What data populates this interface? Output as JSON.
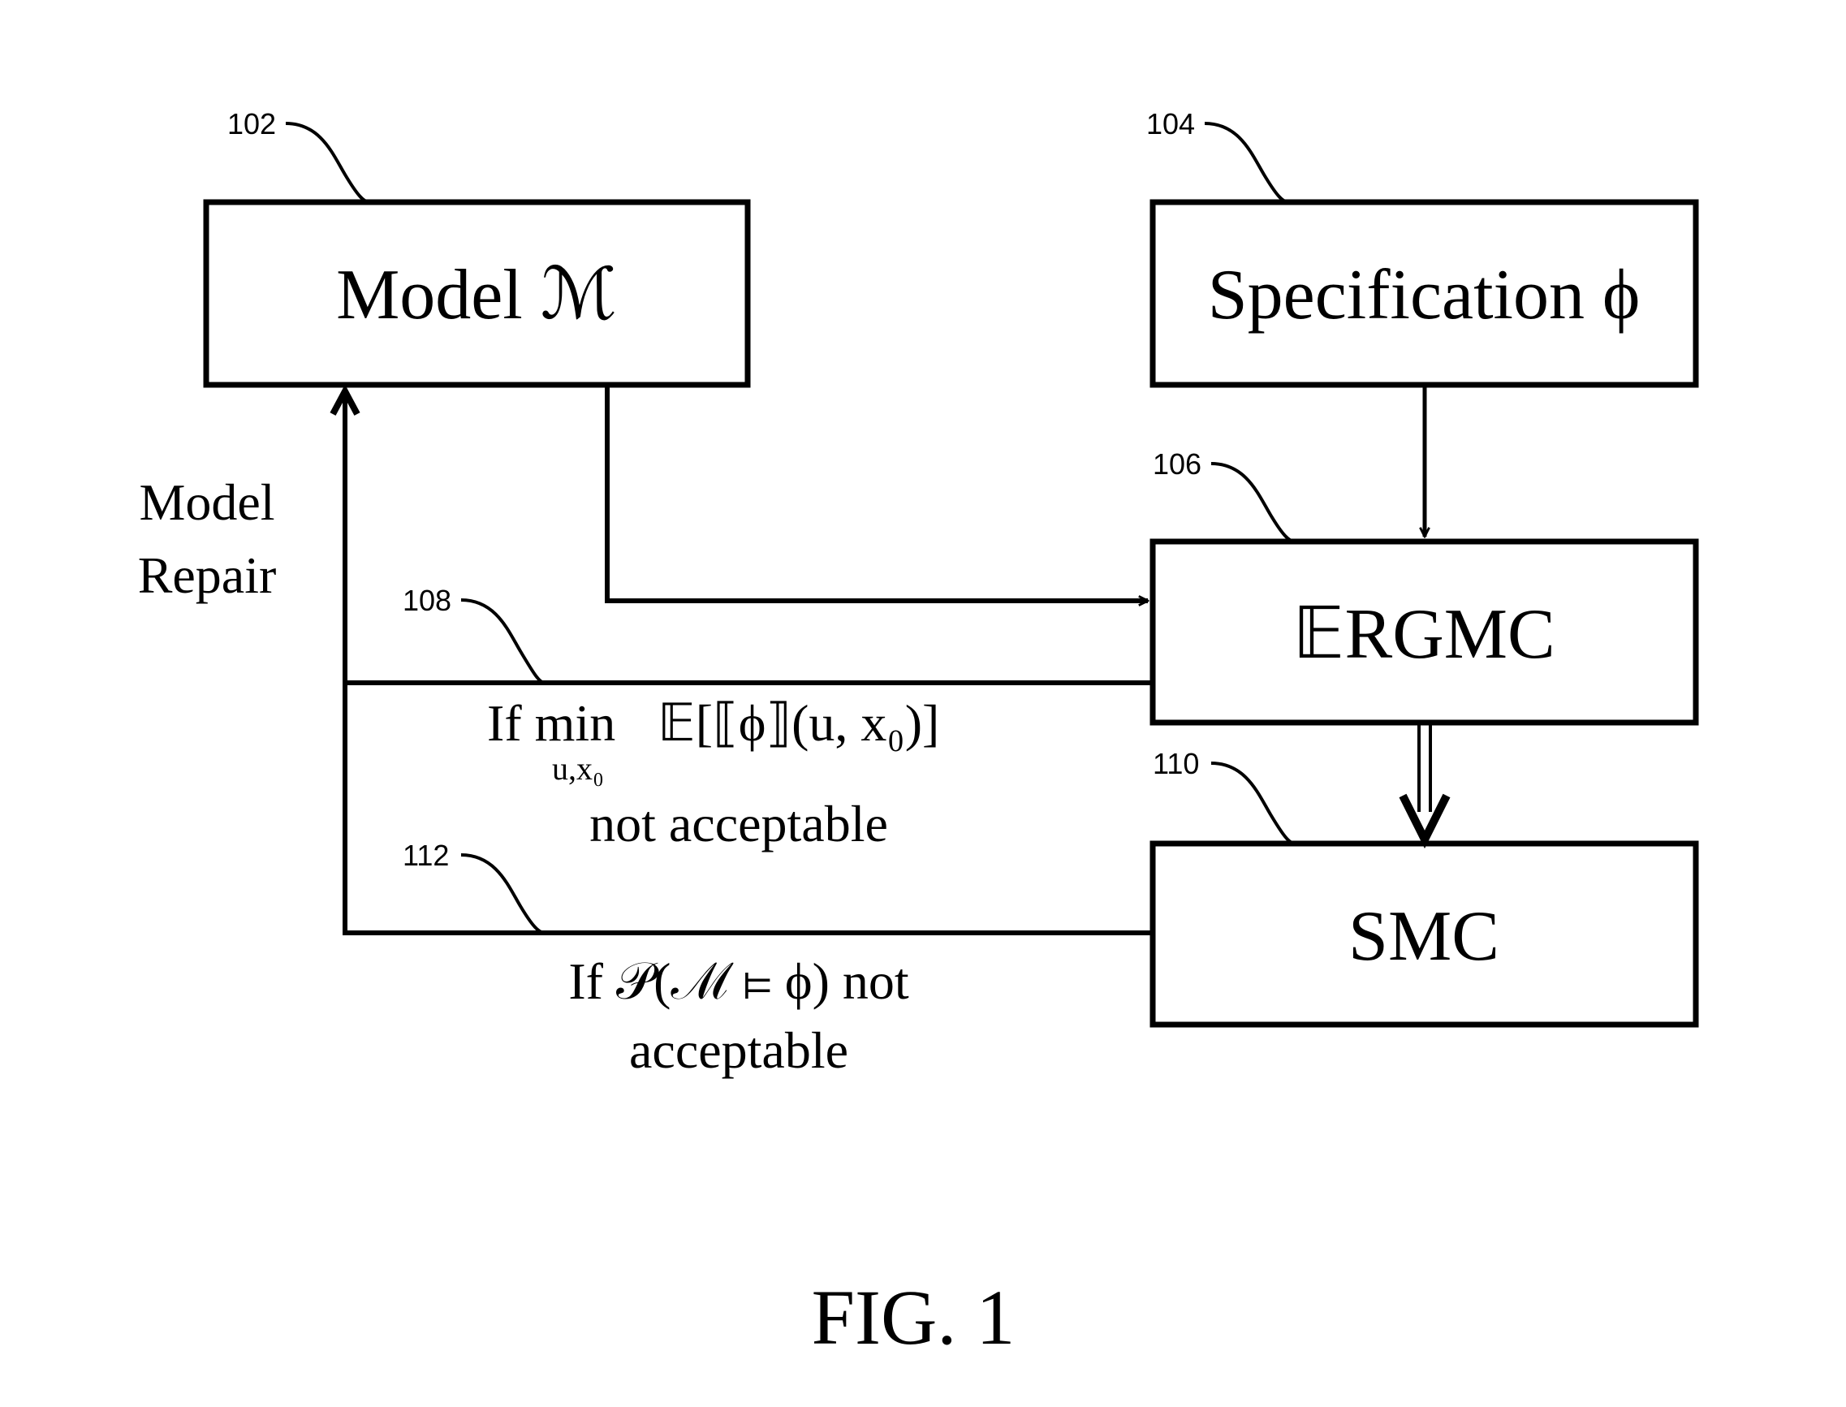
{
  "figure": {
    "caption": "FIG. 1",
    "boxes": [
      {
        "id": "102",
        "label": "Model ℳ"
      },
      {
        "id": "104",
        "label": "Specification ϕ"
      },
      {
        "id": "106",
        "label": "𝔼RGMC"
      },
      {
        "id": "110",
        "label": "SMC"
      }
    ],
    "refs": {
      "r102": "102",
      "r104": "104",
      "r106": "106",
      "r108": "108",
      "r110": "110",
      "r112": "112"
    },
    "side_label": {
      "line1": "Model",
      "line2": "Repair"
    },
    "condition_108": {
      "line1_prefix": "If min",
      "line1_expr": "𝔼[⟦ϕ⟧(u, x₀)]",
      "subscript": "u,x₀",
      "line2": "not acceptable"
    },
    "condition_112": {
      "line1": "If 𝒫(ℳ ⊨ ϕ) not",
      "line2": "acceptable"
    }
  }
}
